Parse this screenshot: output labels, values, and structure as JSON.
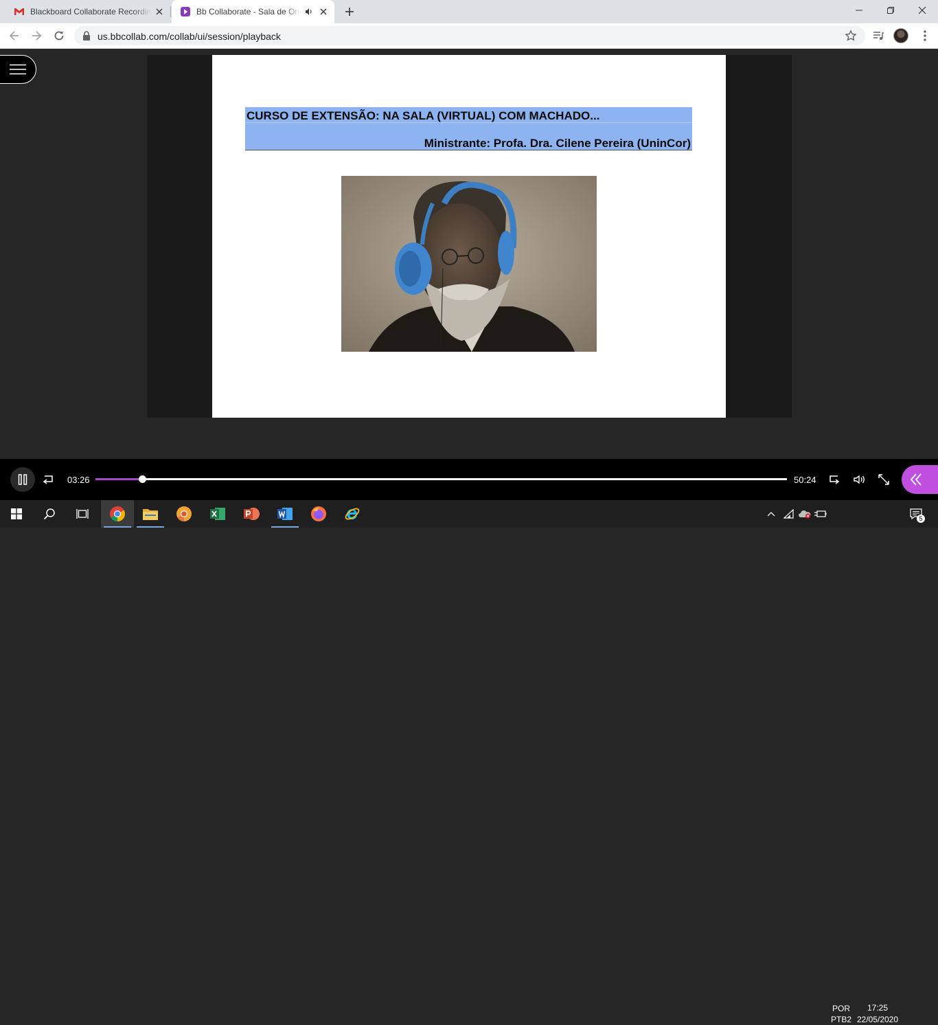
{
  "browser": {
    "tabs": [
      {
        "title": "Blackboard Collaborate Recording",
        "active": false,
        "favicon": "gmail-icon"
      },
      {
        "title": "Bb Collaborate - Sala de Orientação",
        "active": true,
        "favicon": "bb-collaborate-icon",
        "audio": true
      }
    ],
    "url": "us.bbcollab.com/collab/ui/session/playback"
  },
  "slide": {
    "title": "CURSO DE EXTENSÃO: NA SALA (VIRTUAL) COM MACHADO...",
    "subtitle": "Ministrante: Profa. Dra. Cilene Pereira (UninCor)"
  },
  "player": {
    "current_time": "03:26",
    "total_time": "50:24",
    "progress": 0.068,
    "accent": "#a547c8",
    "collab_panel_color": "#c14fe0"
  },
  "taskbar": {
    "apps": [
      "chrome-icon",
      "file-explorer-icon",
      "chrome-canary-icon",
      "excel-icon",
      "powerpoint-icon",
      "word-icon",
      "firefox-icon",
      "internet-explorer-icon"
    ],
    "language": "POR",
    "layout": "PTB2",
    "time": "17:25",
    "date": "22/05/2020",
    "notifications": "5"
  }
}
